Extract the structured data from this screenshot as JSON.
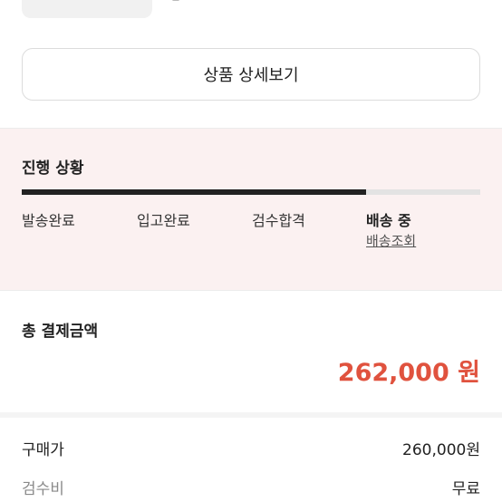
{
  "detail_button": {
    "label": "상품 상세보기"
  },
  "progress": {
    "title": "진행 상황",
    "completed_fraction": 0.75,
    "steps": [
      {
        "label": "발송완료"
      },
      {
        "label": "입고완료"
      },
      {
        "label": "검수합격"
      },
      {
        "label": "배송 중"
      }
    ],
    "tracking_link": "배송조회"
  },
  "payment": {
    "title": "총 결제금액",
    "total": "262,000 원",
    "rows": [
      {
        "label": "구매가",
        "value": "260,000원"
      },
      {
        "label": "검수비",
        "value": "무료"
      }
    ]
  },
  "colors": {
    "accent": "#e0523e",
    "progress_bg": "#fbf1f1",
    "track_fill": "#222222",
    "track_bg": "#e3e3e3"
  }
}
